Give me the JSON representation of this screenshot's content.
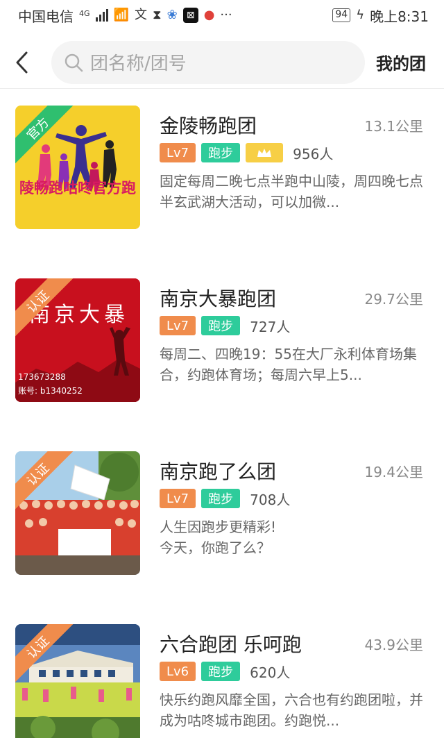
{
  "status_bar": {
    "carrier": "中国电信",
    "network": "4G",
    "battery": "94",
    "time": "晚上8:31"
  },
  "header": {
    "search_placeholder": "团名称/团号",
    "my_team_label": "我的团"
  },
  "clubs": [
    {
      "name": "金陵畅跑团",
      "distance": "13.1公里",
      "badge": "官方",
      "badge_color": "#2fbf6f",
      "level": "Lv7",
      "sport": "跑步",
      "members": "956人",
      "has_crown": true,
      "description": "固定每周二晚七点半跑中山陵，周四晚七点半玄武湖大活动，可以加微...",
      "thumb_text": "陵畅跑咕咚官方跑"
    },
    {
      "name": "南京大暴跑团",
      "distance": "29.7公里",
      "badge": "认证",
      "badge_color": "#f08c4c",
      "level": "Lv7",
      "sport": "跑步",
      "members": "727人",
      "has_crown": false,
      "description": "每周二、四晚19：55在大厂永利体育场集合，约跑体育场；每周六早上5...",
      "thumb_text": "南京大暴",
      "thumb_line1": "173673288",
      "thumb_line2": "账号: b1340252"
    },
    {
      "name": "南京跑了么团",
      "distance": "19.4公里",
      "badge": "认证",
      "badge_color": "#f08c4c",
      "level": "Lv7",
      "sport": "跑步",
      "members": "708人",
      "has_crown": false,
      "description": "人生因跑步更精彩!\n今天，你跑了么？"
    },
    {
      "name": "六合跑团 乐呵跑",
      "distance": "43.9公里",
      "badge": "认证",
      "badge_color": "#f08c4c",
      "level": "Lv6",
      "sport": "跑步",
      "members": "620人",
      "has_crown": false,
      "description": "快乐约跑风靡全国，六合也有约跑团啦，并成为咕咚城市跑团。约跑悦..."
    }
  ]
}
